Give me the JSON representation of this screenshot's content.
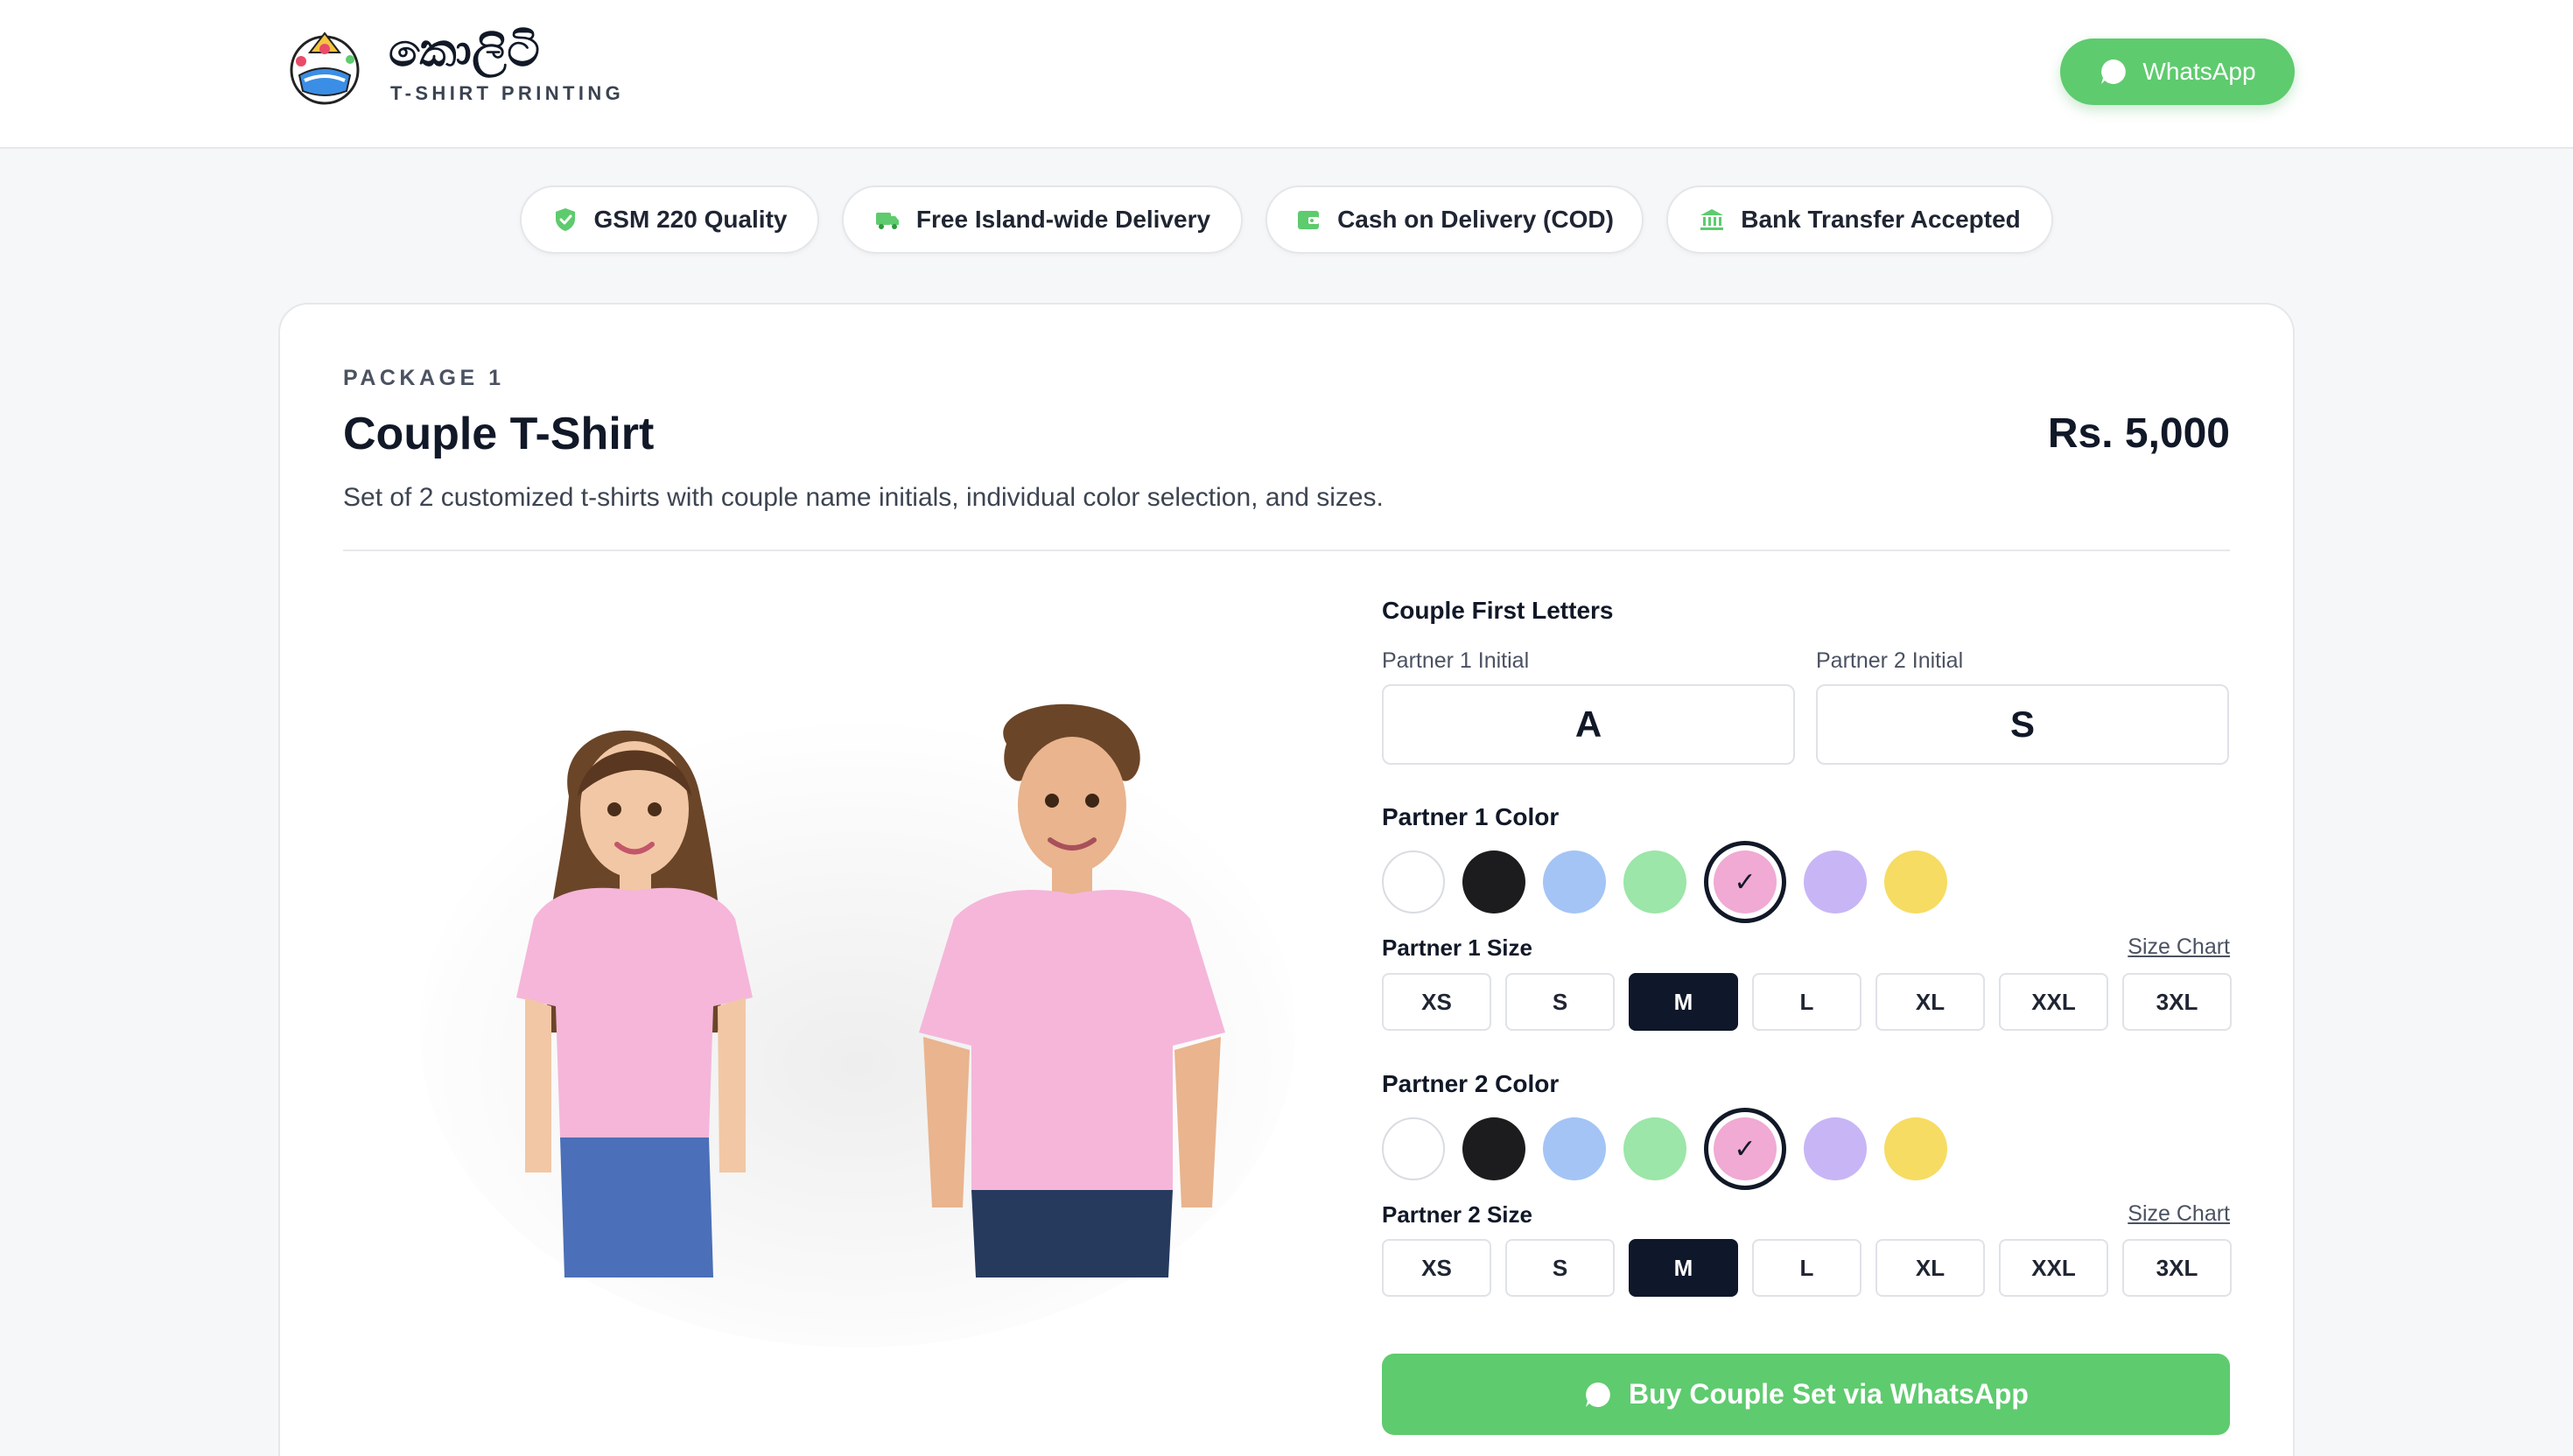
{
  "brand": {
    "title": "කොලිටි",
    "subtitle": "T-SHIRT PRINTING",
    "logo_icon": "logo-icon"
  },
  "header": {
    "whatsapp_label": "WhatsApp",
    "whatsapp_icon": "whatsapp-icon",
    "accent_color": "#5ecb6e"
  },
  "features": [
    {
      "label": "GSM 220 Quality",
      "icon": "shield-check-icon"
    },
    {
      "label": "Free Island-wide Delivery",
      "icon": "truck-icon"
    },
    {
      "label": "Cash on Delivery (COD)",
      "icon": "wallet-icon"
    },
    {
      "label": "Bank Transfer Accepted",
      "icon": "bank-icon"
    }
  ],
  "package": {
    "label": "PACKAGE 1",
    "title": "Couple T-Shirt",
    "price": "Rs. 5,000",
    "description": "Set of 2 customized t-shirts with couple name initials, individual color selection, and sizes."
  },
  "initials": {
    "section_title": "Couple First Letters",
    "partner1_label": "Partner 1 Initial",
    "partner1_value": "A",
    "partner2_label": "Partner 2 Initial",
    "partner2_value": "S"
  },
  "colors": {
    "swatches": [
      "#ffffff",
      "#1c1c1e",
      "#a3c4f5",
      "#9be6a8",
      "#f0aad3",
      "#c8b5f5",
      "#f6dc62"
    ],
    "selected_index": 4,
    "check_mark": "✓"
  },
  "partner1": {
    "color_title": "Partner 1 Color",
    "size_title": "Partner 1 Size",
    "selected_size": "M"
  },
  "partner2": {
    "color_title": "Partner 2 Color",
    "size_title": "Partner 2 Size",
    "selected_size": "M"
  },
  "sizes": [
    "XS",
    "S",
    "M",
    "L",
    "XL",
    "XXL",
    "3XL"
  ],
  "size_chart_label": "Size Chart",
  "buy_button_label": "Buy Couple Set via WhatsApp"
}
